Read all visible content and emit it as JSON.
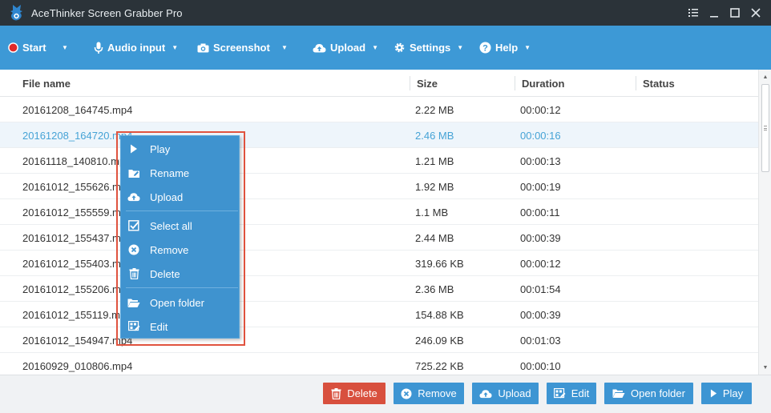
{
  "window": {
    "title": "AceThinker Screen Grabber Pro",
    "controls": [
      "menu-icon",
      "minimize-icon",
      "maximize-icon",
      "close-icon"
    ]
  },
  "toolbar": {
    "start_label": "Start",
    "audio_label": "Audio input",
    "screenshot_label": "Screenshot",
    "upload_label": "Upload",
    "settings_label": "Settings",
    "help_label": "Help"
  },
  "table": {
    "columns": {
      "name": "File name",
      "size": "Size",
      "duration": "Duration",
      "status": "Status"
    },
    "rows": [
      {
        "name": "20161208_164745.mp4",
        "size": "2.22 MB",
        "duration": "00:00:12",
        "status": ""
      },
      {
        "name": "20161208_164720.mp4",
        "size": "2.46 MB",
        "duration": "00:00:16",
        "status": ""
      },
      {
        "name": "20161118_140810.mp4",
        "size": "1.21 MB",
        "duration": "00:00:13",
        "status": ""
      },
      {
        "name": "20161012_155626.mp4",
        "size": "1.92 MB",
        "duration": "00:00:19",
        "status": ""
      },
      {
        "name": "20161012_155559.mp4",
        "size": "1.1 MB",
        "duration": "00:00:11",
        "status": ""
      },
      {
        "name": "20161012_155437.mp4",
        "size": "2.44 MB",
        "duration": "00:00:39",
        "status": ""
      },
      {
        "name": "20161012_155403.mp4",
        "size": "319.66 KB",
        "duration": "00:00:12",
        "status": ""
      },
      {
        "name": "20161012_155206.mp4",
        "size": "2.36 MB",
        "duration": "00:01:54",
        "status": ""
      },
      {
        "name": "20161012_155119.mp4",
        "size": "154.88 KB",
        "duration": "00:00:39",
        "status": ""
      },
      {
        "name": "20161012_154947.mp4",
        "size": "246.09 KB",
        "duration": "00:01:03",
        "status": ""
      },
      {
        "name": "20160929_010806.mp4",
        "size": "725.22 KB",
        "duration": "00:00:10",
        "status": ""
      }
    ],
    "selected_row": 1
  },
  "context_menu": {
    "items": [
      {
        "label": "Play",
        "icon": "play-icon"
      },
      {
        "label": "Rename",
        "icon": "rename-folder-icon"
      },
      {
        "label": "Upload",
        "icon": "cloud-upload-icon"
      },
      {
        "label": "Select all",
        "icon": "checkbox-icon"
      },
      {
        "label": "Remove",
        "icon": "remove-circle-icon"
      },
      {
        "label": "Delete",
        "icon": "trash-icon"
      },
      {
        "label": "Open folder",
        "icon": "folder-open-icon"
      },
      {
        "label": "Edit",
        "icon": "edit-icon"
      }
    ]
  },
  "bottom_buttons": {
    "delete_label": "Delete",
    "remove_label": "Remove",
    "upload_label": "Upload",
    "edit_label": "Edit",
    "open_folder_label": "Open folder",
    "play_label": "Play"
  },
  "colors": {
    "toolbar": "#3d99d6",
    "titlebar": "#2b3339",
    "context_menu": "#3f93cf",
    "highlight_outline": "#e0533f",
    "delete_button": "#d8503e",
    "selected_text": "#46a3d6",
    "record_dot": "#e02a2a"
  }
}
